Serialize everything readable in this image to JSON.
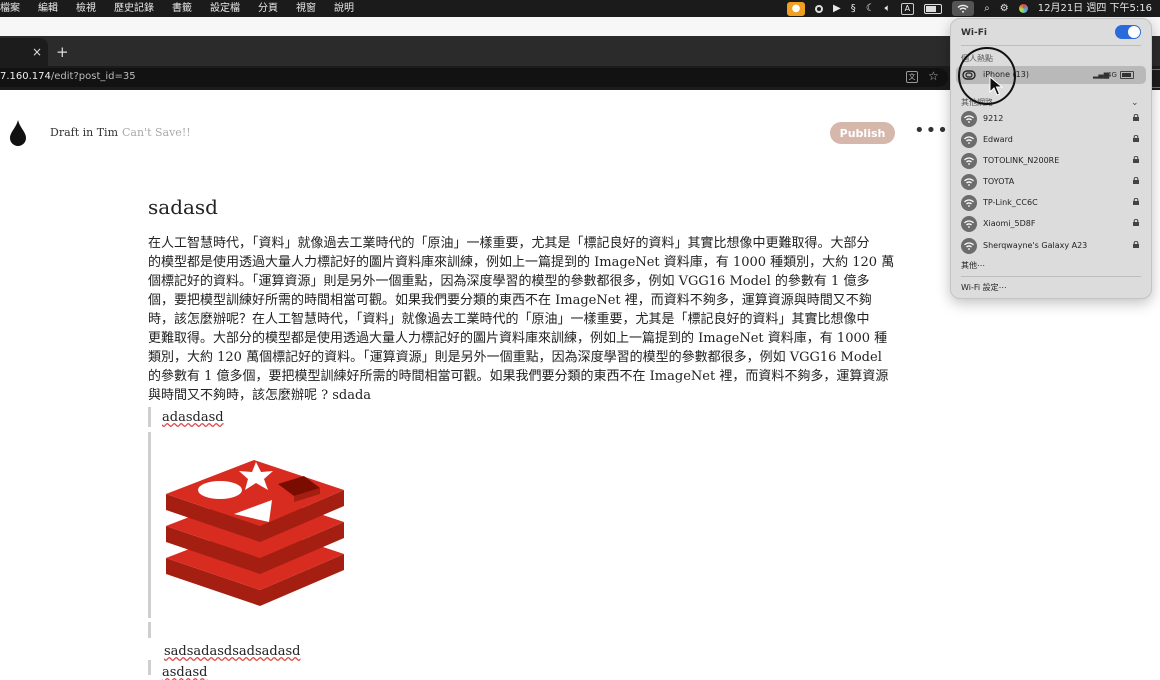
{
  "menubar": {
    "menus": [
      "檔案",
      "編輯",
      "檢視",
      "歷史記錄",
      "書籤",
      "設定檔",
      "分頁",
      "視窗",
      "說明"
    ],
    "datetime": "12月21日 週四 下午5:16",
    "input_badge": "A"
  },
  "browser": {
    "tab_close": "×",
    "new_tab": "+",
    "url_host": "7.160.174",
    "url_path": "/edit?post_id=35"
  },
  "editor": {
    "draft_label": "Draft in Tim",
    "status_text": "Can't Save!!",
    "publish_label": "Publish",
    "more_label": "•••"
  },
  "post": {
    "title": "sadasd",
    "paragraph_lines": [
      "在人工智慧時代，「資料」就像過去工業時代的「原油」一樣重要，尤其是「標記良好的資料」其實比想像中更難取得。大部分",
      "的模型都是使用透過大量人力標記好的圖片資料庫來訓練，例如上一篇提到的 ImageNet 資料庫，有 1000 種類別，大約 120 萬",
      "個標記好的資料。「運算資源」則是另外一個重點，因為深度學習的模型的參數都很多，例如 VGG16 Model 的參數有 1 億多",
      "個，要把模型訓練好所需的時間相當可觀。如果我們要分類的東西不在 ImageNet 裡，而資料不夠多，運算資源與時間又不夠",
      "時，該怎麼辦呢？在人工智慧時代，「資料」就像過去工業時代的「原油」一樣重要，尤其是「標記良好的資料」其實比想像中",
      "更難取得。大部分的模型都是使用透過大量人力標記好的圖片資料庫來訓練，例如上一篇提到的 ImageNet 資料庫，有 1000 種",
      "類別，大約 120 萬個標記好的資料。「運算資源」則是另外一個重點，因為深度學習的模型的參數都很多，例如 VGG16 Model",
      "的參數有 1 億多個，要把模型訓練好所需的時間相當可觀。如果我們要分類的東西不在 ImageNet 裡，而資料不夠多，運算資源",
      "與時間又不夠時，該怎麼辦呢 ? sdada"
    ],
    "quote_1": "adasdasd",
    "quote_2": "sadsadasdsadsadasd",
    "quote_3": "asdasd"
  },
  "wifi_panel": {
    "title": "Wi-Fi",
    "enabled": true,
    "hotspot_section": "個人熱點",
    "hotspot": {
      "name": "iPhone (13)",
      "network_type": "4G"
    },
    "other_section": "其他網路",
    "networks": [
      "9212",
      "Edward",
      "TOTOLINK_N200RE",
      "TOYOTA",
      "TP-Link_CC6C",
      "Xiaomi_5D8F",
      "Sherqwayne's Galaxy A23"
    ],
    "other_label": "其他⋯",
    "settings_label": "Wi-Fi 設定⋯"
  },
  "colors": {
    "publish_bg": "#d5b7ab",
    "toggle_on": "#2a6bdb",
    "redis_red": "#d82c20"
  }
}
